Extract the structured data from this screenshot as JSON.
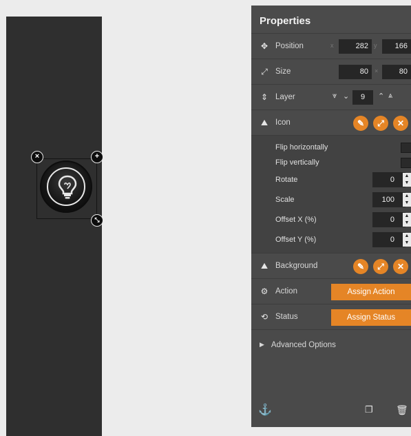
{
  "colors": {
    "accent": "#e58526",
    "panel_bg": "#4a4a4a",
    "canvas_bg": "#2f2f2f",
    "input_bg": "#262626"
  },
  "canvas": {
    "widget": {
      "icon": "lightbulb-icon",
      "handles": [
        "close-icon",
        "add-icon",
        "resize-icon"
      ]
    }
  },
  "panel": {
    "title": "Properties",
    "position": {
      "label": "Position",
      "x_sep": "x",
      "x": "282",
      "y_sep": "y",
      "y": "166"
    },
    "size": {
      "label": "Size",
      "w": "80",
      "h_sep": "×",
      "h": "80"
    },
    "layer": {
      "label": "Layer",
      "value": "9"
    },
    "icon": {
      "label": "Icon"
    },
    "icon_options": {
      "flip_h": "Flip horizontally",
      "flip_v": "Flip vertically",
      "rotate": {
        "label": "Rotate",
        "value": "0"
      },
      "scale": {
        "label": "Scale",
        "value": "100"
      },
      "offset_x": {
        "label": "Offset X (%)",
        "value": "0"
      },
      "offset_y": {
        "label": "Offset Y (%)",
        "value": "0"
      }
    },
    "background": {
      "label": "Background"
    },
    "action": {
      "label": "Action",
      "button": "Assign Action"
    },
    "status": {
      "label": "Status",
      "button": "Assign Status"
    },
    "advanced": "Advanced Options"
  }
}
